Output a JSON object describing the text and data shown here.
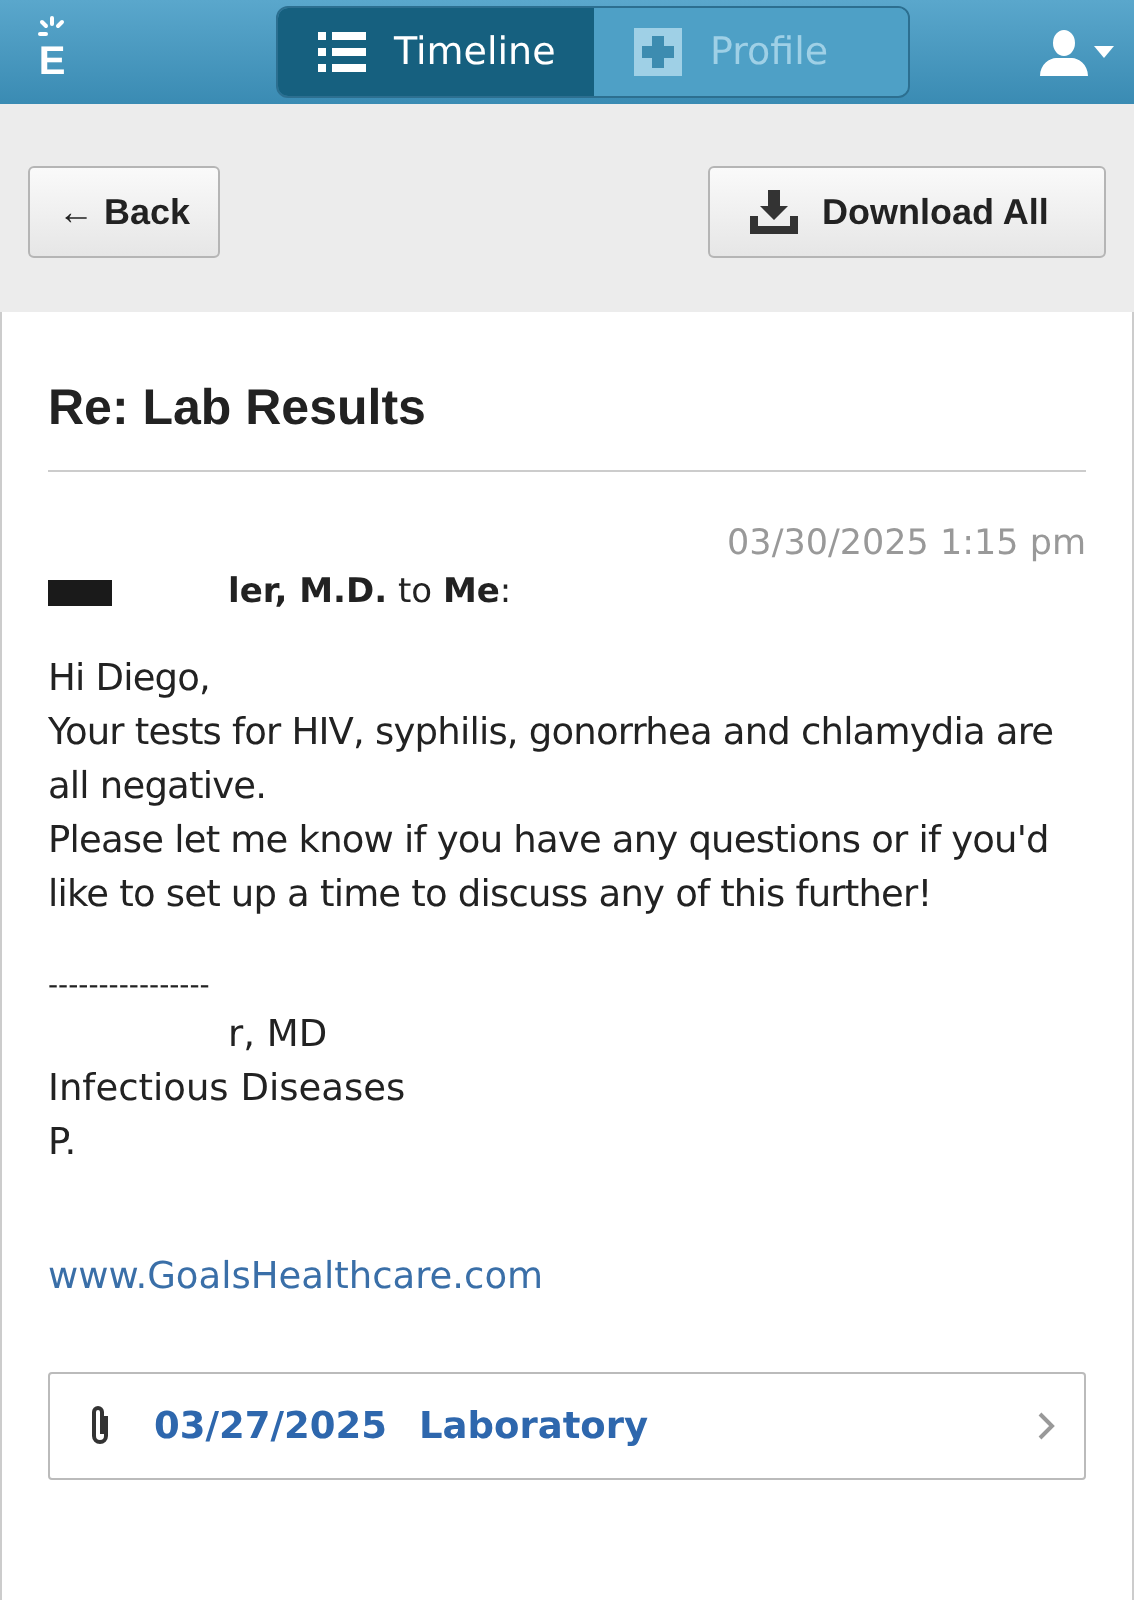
{
  "app_bar": {
    "logo": "E",
    "tabs": [
      {
        "label": "Timeline",
        "kind": "list",
        "selected": true
      },
      {
        "label": "Profile",
        "kind": "cross",
        "selected": false
      }
    ]
  },
  "toolbar": {
    "back": "← Back",
    "download": "Download All"
  },
  "message": {
    "subject": "Re: Lab Results",
    "timestamp": "03/30/2025 1:15 pm",
    "sender": "ler, M.D.",
    "to_word": "to",
    "recipient": "Me",
    "colon": ":",
    "body": [
      "Hi Diego,",
      "Your tests for HIV, syphilis, gonorrhea and chlamydia are all negative.",
      "Please let me know if you have any questions or if you'd like to set up a time to discuss any of this further!"
    ],
    "signature": [
      "----------------",
      "r, MD",
      "Infectious Diseases",
      "P."
    ],
    "link": "www.GoalsHealthcare.com"
  },
  "attachment": {
    "date": "03/27/2025",
    "label": "Laboratory"
  }
}
